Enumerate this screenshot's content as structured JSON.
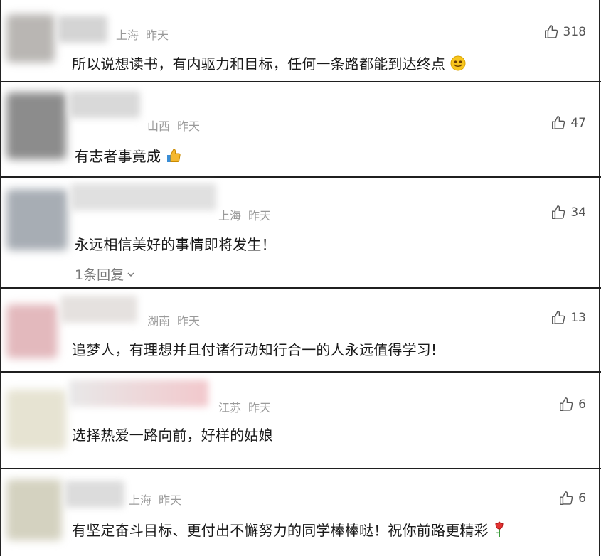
{
  "comments": [
    {
      "location": "上海",
      "time": "昨天",
      "likes": "318",
      "text": "所以说想读书，有内驱力和目标，任何一条路都能到达终点",
      "emoji": "smile-emoji"
    },
    {
      "location": "山西",
      "time": "昨天",
      "likes": "47",
      "text": "有志者事竟成",
      "emoji": "thumbs-up-emoji"
    },
    {
      "location": "上海",
      "time": "昨天",
      "likes": "34",
      "text": "永远相信美好的事情即将发生！",
      "reply_label": "1条回复"
    },
    {
      "location": "湖南",
      "time": "昨天",
      "likes": "13",
      "text": "追梦人，有理想并且付诸行动知行合一的人永远值得学习!"
    },
    {
      "location": "江苏",
      "time": "昨天",
      "likes": "6",
      "text": "选择热爱一路向前，好样的姑娘"
    },
    {
      "location": "上海",
      "time": "昨天",
      "likes": "6",
      "text": "有坚定奋斗目标、更付出不懈努力的同学棒棒哒！祝你前路更精彩",
      "emoji": "rose-emoji"
    }
  ]
}
